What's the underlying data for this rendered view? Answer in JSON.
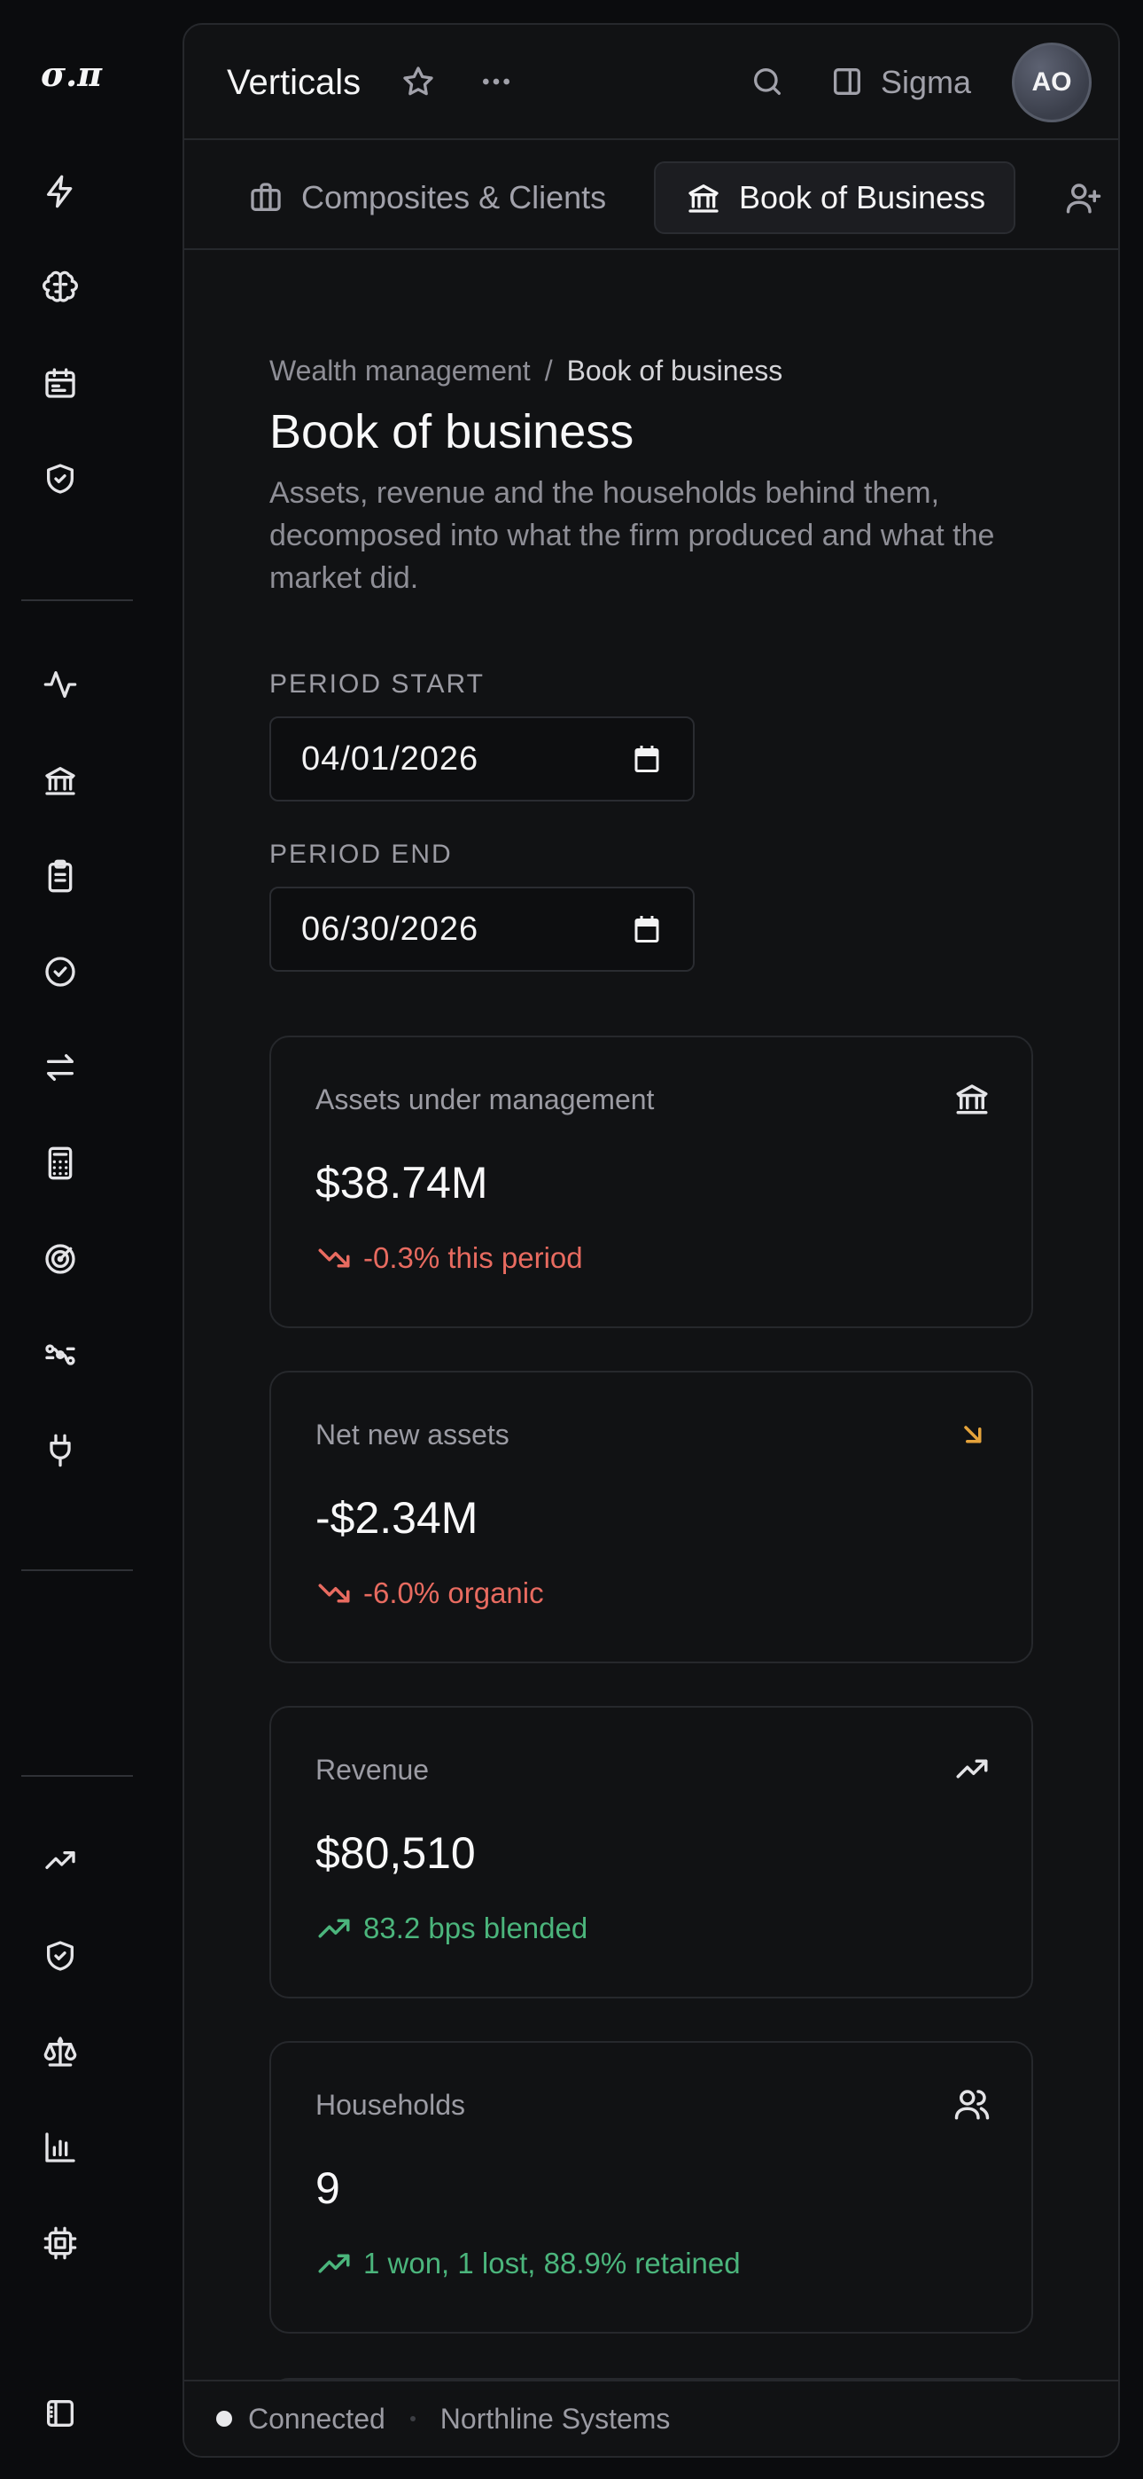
{
  "rail": {
    "logo": "σ.π",
    "top_icons": [
      "bolt-icon",
      "brain-icon",
      "calendar-icon",
      "shield-check-icon"
    ],
    "mid_icons": [
      "activity-icon",
      "bank-icon",
      "clipboard-icon",
      "badge-check-icon",
      "arrows-left-right-icon",
      "calculator-icon",
      "radar-icon",
      "workflow-icon",
      "plug-icon"
    ],
    "bottom_icons": [
      "trending-up-icon",
      "shield-check-icon",
      "scale-icon",
      "bar-chart-icon",
      "cpu-icon"
    ],
    "footer_icon": "sidebar-toggle-icon"
  },
  "topbar": {
    "title": "Verticals",
    "sigma_label": "Sigma",
    "avatar_initials": "AO"
  },
  "tabs": [
    {
      "label": "Composites & Clients",
      "icon": "briefcase-icon",
      "active": false
    },
    {
      "label": "Book of Business",
      "icon": "bank-icon",
      "active": true
    }
  ],
  "page": {
    "breadcrumb": {
      "parent": "Wealth management",
      "separator": "/",
      "current": "Book of business"
    },
    "title": "Book of business",
    "subtitle": "Assets, revenue and the households behind them, decomposed into what the firm produced and what the market did."
  },
  "period": {
    "start_label": "PERIOD START",
    "start_value": "04/01/2026",
    "end_label": "PERIOD END",
    "end_value": "06/30/2026"
  },
  "cards": [
    {
      "label": "Assets under management",
      "value": "$38.74M",
      "delta": "-0.3% this period",
      "trend": "down",
      "icon": "bank-icon",
      "icon_color": "#e4e4e7"
    },
    {
      "label": "Net new assets",
      "value": "-$2.34M",
      "delta": "-6.0% organic",
      "trend": "down",
      "icon": "arrow-down-right-icon",
      "icon_color": "#e5a33b"
    },
    {
      "label": "Revenue",
      "value": "$80,510",
      "delta": "83.2 bps blended",
      "trend": "up",
      "icon": "trending-up-icon",
      "icon_color": "#e4e4e7"
    },
    {
      "label": "Households",
      "value": "9",
      "delta": "1 won, 1 lost, 88.9% retained",
      "trend": "up",
      "icon": "users-icon",
      "icon_color": "#e4e4e7"
    }
  ],
  "status": {
    "connection": "Connected",
    "org": "Northline Systems"
  },
  "colors": {
    "negative": "#e86b60",
    "positive": "#4bb57c",
    "warning": "#e5a33b"
  }
}
